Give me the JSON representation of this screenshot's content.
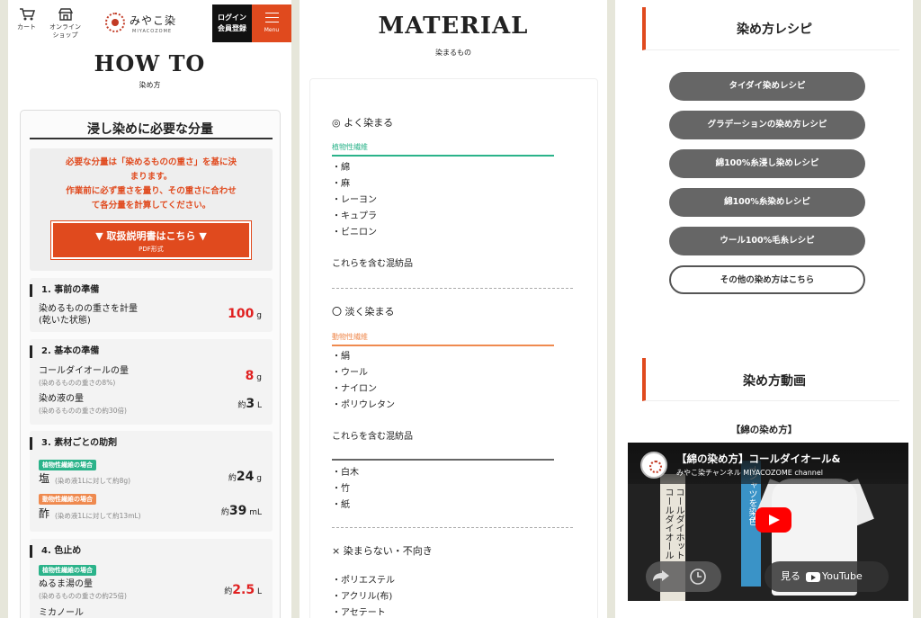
{
  "header": {
    "cart_label": "カート",
    "shop_label_1": "オンライン",
    "shop_label_2": "ショップ",
    "logo_text": "みやこ染",
    "logo_sub": "MIYACOZOME",
    "login_line1": "ログイン",
    "login_line2": "会員登録",
    "menu_label": "Menu"
  },
  "howto": {
    "title": "HOW TO",
    "subtitle": "染め方",
    "card_title": "浸し染めに必要な分量",
    "notice_line1": "必要な分量は「染めるものの重さ」を基に決",
    "notice_line2": "まります。",
    "notice_line3": "作業前に必ず重さを量り、その重さに合わせ",
    "notice_line4": "て各分量を計算してください。",
    "pdf_label": "▼ 取扱説明書はこちら ▼",
    "pdf_sub": "PDF形式",
    "colors": {
      "accent": "#e04a1e",
      "red_value": "#e02020",
      "plant": "#2bb38a",
      "animal": "#ef8a4f"
    },
    "sections": [
      {
        "heading": "1. 事前の準備",
        "rows": [
          {
            "label1": "染めるものの重さを計量",
            "label2": "(乾いた状態)",
            "value": "100",
            "unit": "g"
          }
        ]
      },
      {
        "heading": "2. 基本の準備",
        "rows": [
          {
            "label": "コールダイオールの量",
            "note": "(染めるものの重さの8%)",
            "value": "8",
            "unit": "g"
          },
          {
            "label": "染め液の量",
            "note": "(染めるものの重さの約30倍)",
            "prefix": "約",
            "value": "3",
            "unit": "L"
          }
        ]
      },
      {
        "heading": "3. 素材ごとの助剤",
        "rows": [
          {
            "badge": "植物性繊維の場合",
            "label": "塩",
            "note": "(染め液1Lに対して約8g)",
            "prefix": "約",
            "value": "24",
            "unit": "g"
          },
          {
            "badge": "動物性繊維の場合",
            "label": "酢",
            "note": "(染め液1Lに対して約13mL)",
            "prefix": "約",
            "value": "39",
            "unit": "mL"
          }
        ]
      },
      {
        "heading": "4. 色止め",
        "rows": [
          {
            "badge": "植物性繊維の場合",
            "label": "ぬるま湯の量",
            "note": "(染めるものの重さの約25倍)",
            "prefix": "約",
            "value": "2.5",
            "unit": "L"
          },
          {
            "label": "ミカノール"
          }
        ]
      }
    ]
  },
  "material": {
    "title": "MATERIAL",
    "subtitle": "染まるもの",
    "good_title": "◎ よく染まる",
    "plant_label": "植物性繊維",
    "plant_items": [
      "・綿",
      "・麻",
      "・レーヨン",
      "・キュプラ",
      "・ビニロン"
    ],
    "mix_label": "これらを含む混紡品",
    "light_title": "〇 淡く染まる",
    "animal_label": "動物性繊維",
    "animal_items": [
      "・絹",
      "・ウール",
      "・ナイロン",
      "・ポリウレタン"
    ],
    "mix_label_2": "これらを含む混紡品",
    "other_items": [
      "・白木",
      "・竹",
      "・紙"
    ],
    "bad_title": "× 染まらない・不向き",
    "bad_items": [
      "・ポリエステル",
      "・アクリル(布)",
      "・アセテート"
    ],
    "colors": {
      "plant": "#2bb38a",
      "animal": "#ef8a4f"
    }
  },
  "recipes": {
    "title": "染め方レシピ",
    "buttons": [
      "タイダイ染めレシピ",
      "グラデーションの染め方レシピ",
      "綿100%糸浸し染めレシピ",
      "綿100%糸染めレシピ",
      "ウール100%毛糸レシピ"
    ],
    "other_button": "その他の染め方はこちら"
  },
  "video": {
    "section_title": "染め方動画",
    "subtitle": "【綿の染め方】",
    "title": "【綿の染め方】コールダイオール&",
    "channel": "みやこ染チャンネル MIYACOZOME channel",
    "thumb_text_1": "コールダイホット",
    "thumb_text_2": "コールダイオール",
    "thumb_text_3": "Tシャツを染色",
    "watch_label": "見る",
    "youtube_label": "YouTube"
  }
}
